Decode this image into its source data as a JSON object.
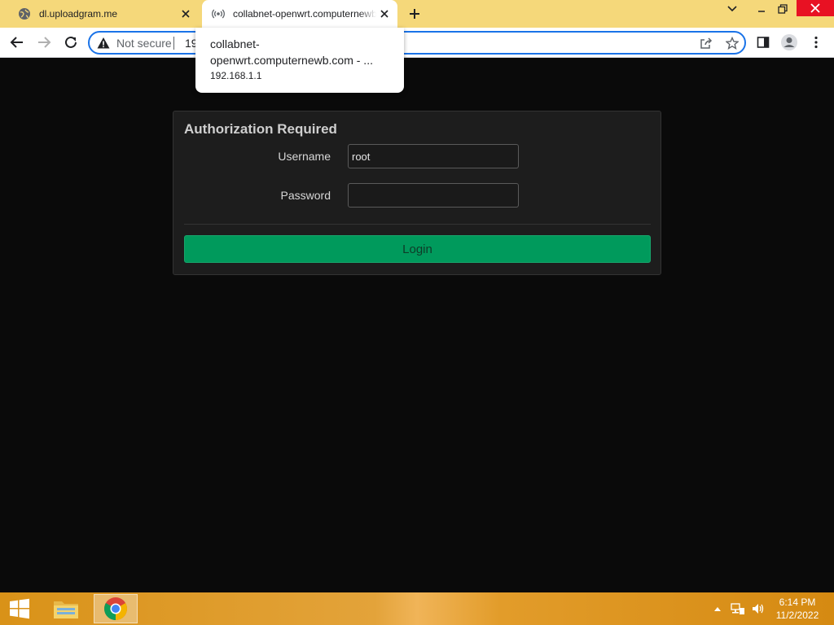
{
  "browser": {
    "tabs": [
      {
        "title": "dl.uploadgram.me",
        "icon": "globe-icon",
        "active": false
      },
      {
        "title": "collabnet-openwrt.computernewb.com",
        "icon": "broadcast-icon",
        "active": true
      }
    ],
    "address_bar": {
      "security_label": "Not secure",
      "url_visible": "19"
    },
    "hover_card": {
      "title": "collabnet-openwrt.computernewb.com - ...",
      "url": "192.168.1.1"
    }
  },
  "page": {
    "panel_title": "Authorization Required",
    "username_label": "Username",
    "username_value": "root",
    "password_label": "Password",
    "password_value": "",
    "login_label": "Login"
  },
  "taskbar": {
    "time": "6:14 PM",
    "date": "11/2/2022"
  },
  "colors": {
    "tabstrip": "#f5d87a",
    "accent": "#1a73e8",
    "login_button": "#009a5c",
    "page_background": "#0a0a0a"
  }
}
